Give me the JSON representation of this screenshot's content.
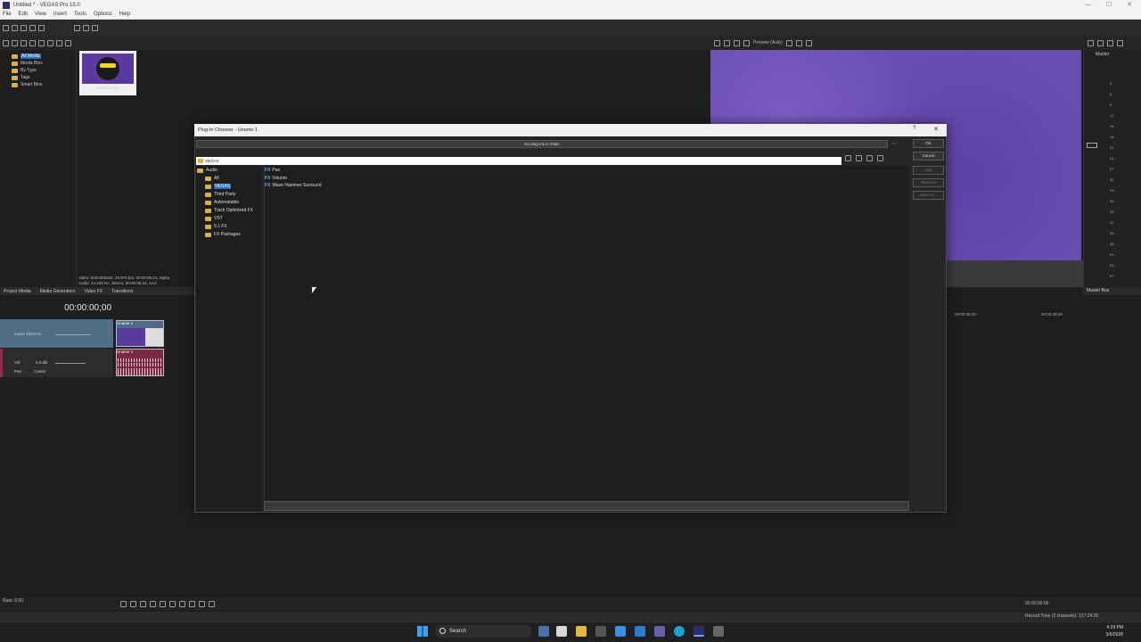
{
  "window": {
    "title": "Untitled * - VEGAS Pro 15.0"
  },
  "menu": [
    "File",
    "Edit",
    "View",
    "Insert",
    "Tools",
    "Options",
    "Help"
  ],
  "media_tree": {
    "items": [
      {
        "label": "All Media",
        "selected": true,
        "indent": 1
      },
      {
        "label": "Media Bins",
        "selected": false,
        "indent": 1
      },
      {
        "label": "By Type",
        "selected": false,
        "indent": 1
      },
      {
        "label": "Tags",
        "selected": false,
        "indent": 1
      },
      {
        "label": "Smart Bins",
        "selected": false,
        "indent": 1
      }
    ]
  },
  "media_thumb": {
    "caption": "Uname 1.mp4"
  },
  "media_info": {
    "line1": "Video: 640x360x32, 29.970 fps, 00:00:05;24, Alpha",
    "line2": "Audio: 44,100 Hz, Stereo, 00:00:05;24, AAC"
  },
  "left_tabs": [
    "Project Media",
    "Media Generators",
    "Video FX",
    "Transitions"
  ],
  "preview": {
    "label": "Preview (Auto)"
  },
  "master": {
    "label": "Master",
    "footer": "Master Bus",
    "ticks": [
      "3",
      "6",
      "9",
      "12",
      "15",
      "18",
      "21",
      "24",
      "27",
      "30",
      "33",
      "36",
      "39",
      "42",
      "45",
      "48",
      "51",
      "54",
      "57"
    ]
  },
  "timeline": {
    "timecode": "00:00:00;00",
    "ruler_right": [
      "00:00:29;29",
      "00:00:49;29"
    ],
    "track1": {
      "level": "Level: 100.0 %",
      "clip_label": "Uname 1"
    },
    "track2": {
      "vol_label": "Vol:",
      "vol_value": "0.0 dB",
      "pan_label": "Pan:",
      "pan_value": "Center",
      "clip_label": "Uname 1"
    },
    "rate": "Rate: 0.00",
    "end_timecode": "00:00:00;00",
    "record_time": "Record Time (2 channels): 217:24:35"
  },
  "dialog": {
    "title": "Plug-In Chooser - Uname 1",
    "chain_text": "No plug-ins in chain",
    "path": "VEGAS",
    "buttons": {
      "ok": "OK",
      "cancel": "Cancel",
      "add": "Add",
      "remove": "Remove",
      "save_as": "Save As..."
    },
    "tree": [
      {
        "label": "Audio",
        "indent": 0,
        "selected": false
      },
      {
        "label": "All",
        "indent": 1,
        "selected": false
      },
      {
        "label": "VEGAS",
        "indent": 1,
        "selected": true
      },
      {
        "label": "Third Party",
        "indent": 1,
        "selected": false
      },
      {
        "label": "Automatable",
        "indent": 1,
        "selected": false
      },
      {
        "label": "Track Optimized FX",
        "indent": 1,
        "selected": false
      },
      {
        "label": "VST",
        "indent": 1,
        "selected": false
      },
      {
        "label": "5.1 FX",
        "indent": 1,
        "selected": false
      },
      {
        "label": "FX Packages",
        "indent": 1,
        "selected": false
      }
    ],
    "fx_tag": "FX",
    "plugins": [
      "Pan",
      "Volume",
      "Wave Hammer Surround"
    ]
  },
  "taskbar": {
    "search": "Search",
    "time": "4:29 PM",
    "date": "3/6/2026"
  }
}
